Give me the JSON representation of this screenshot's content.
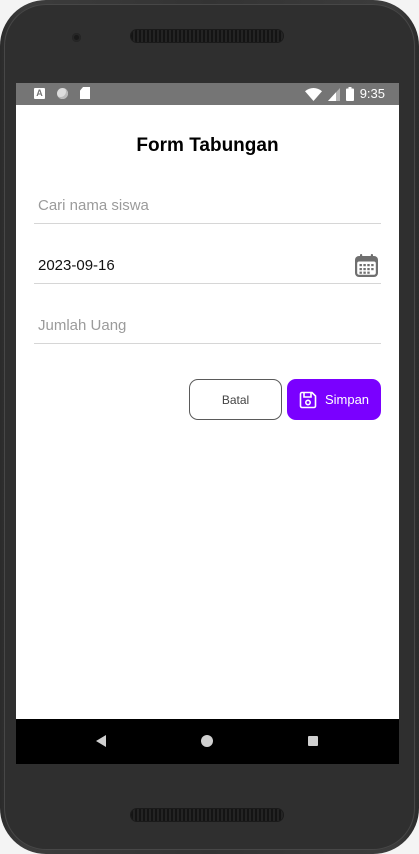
{
  "statusbar": {
    "a_icon_label": "A",
    "time": "9:35",
    "icons": [
      "a-icon",
      "sync-icon",
      "sd-card-icon",
      "wifi-icon",
      "signal-icon",
      "battery-icon"
    ]
  },
  "form": {
    "title": "Form Tabungan",
    "student_search": {
      "placeholder": "Cari nama siswa",
      "value": ""
    },
    "date": {
      "value": "2023-09-16",
      "icon": "calendar-icon"
    },
    "amount": {
      "placeholder": "Jumlah Uang",
      "value": ""
    }
  },
  "buttons": {
    "cancel_label": "Batal",
    "save_label": "Simpan",
    "save_icon": "save-icon"
  },
  "colors": {
    "accent": "#7A00FF",
    "statusbar": "#757575",
    "navbar": "#000000",
    "divider": "#D6D6D6",
    "placeholder": "#9B9B9B"
  },
  "navbar": {
    "icons": [
      "back-icon",
      "home-icon",
      "recents-icon"
    ]
  }
}
